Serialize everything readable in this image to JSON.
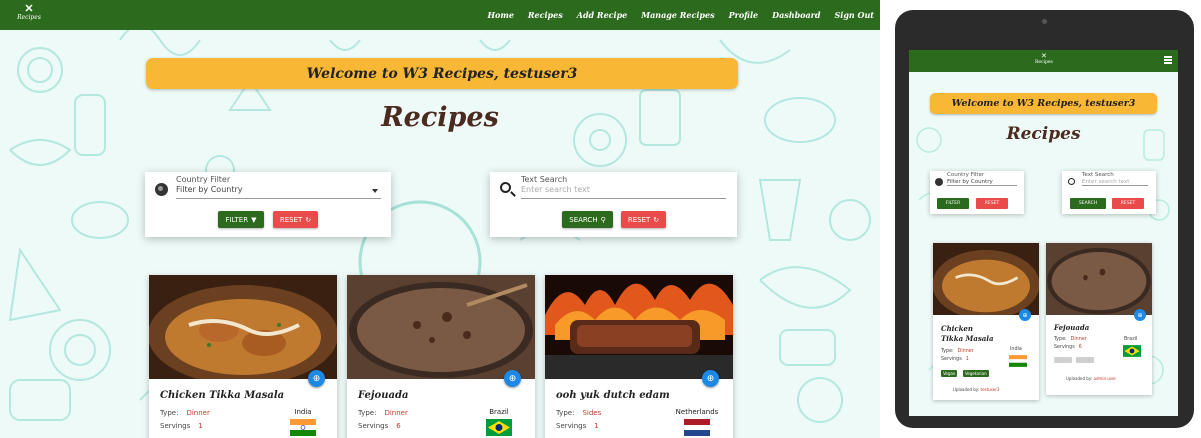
{
  "brand": {
    "logo_mark": "W3",
    "logo_sub": "Recipes"
  },
  "nav": {
    "items": [
      "Home",
      "Recipes",
      "Add Recipe",
      "Manage Recipes",
      "Profile",
      "Dashboard",
      "Sign Out"
    ]
  },
  "welcome": "Welcome to W3 Recipes, testuser3",
  "page_title": "Recipes",
  "country_filter": {
    "label": "Country Filter",
    "value": "Filter by Country",
    "filter_button": "FILTER",
    "reset_button": "RESET"
  },
  "text_search": {
    "label": "Text Search",
    "placeholder": "Enter search text",
    "search_button": "SEARCH",
    "reset_button": "RESET"
  },
  "recipes": [
    {
      "title": "Chicken Tikka Masala",
      "type_label": "Type:",
      "type": "Dinner",
      "servings_label": "Servings",
      "servings": "1",
      "country": "India"
    },
    {
      "title": "Fejouada",
      "type_label": "Type:",
      "type": "Dinner",
      "servings_label": "Servings",
      "servings": "6",
      "country": "Brazil"
    },
    {
      "title": "ooh yuk dutch edam",
      "type_label": "Type:",
      "type": "Sides",
      "servings_label": "Servings",
      "servings": "1",
      "country": "Netherlands"
    }
  ],
  "tablet": {
    "badges": [
      "Vegan",
      "Vegetarian"
    ],
    "uploaded_by_label": "Uploaded by:",
    "uploaders": [
      "testuser3",
      "admin.user"
    ]
  },
  "colors": {
    "nav_green": "#2c6b1e",
    "welcome_yellow": "#f8b735",
    "reset_red": "#e94b4b",
    "zoom_blue": "#1e88e5",
    "title_brown": "#4b2a1f"
  }
}
